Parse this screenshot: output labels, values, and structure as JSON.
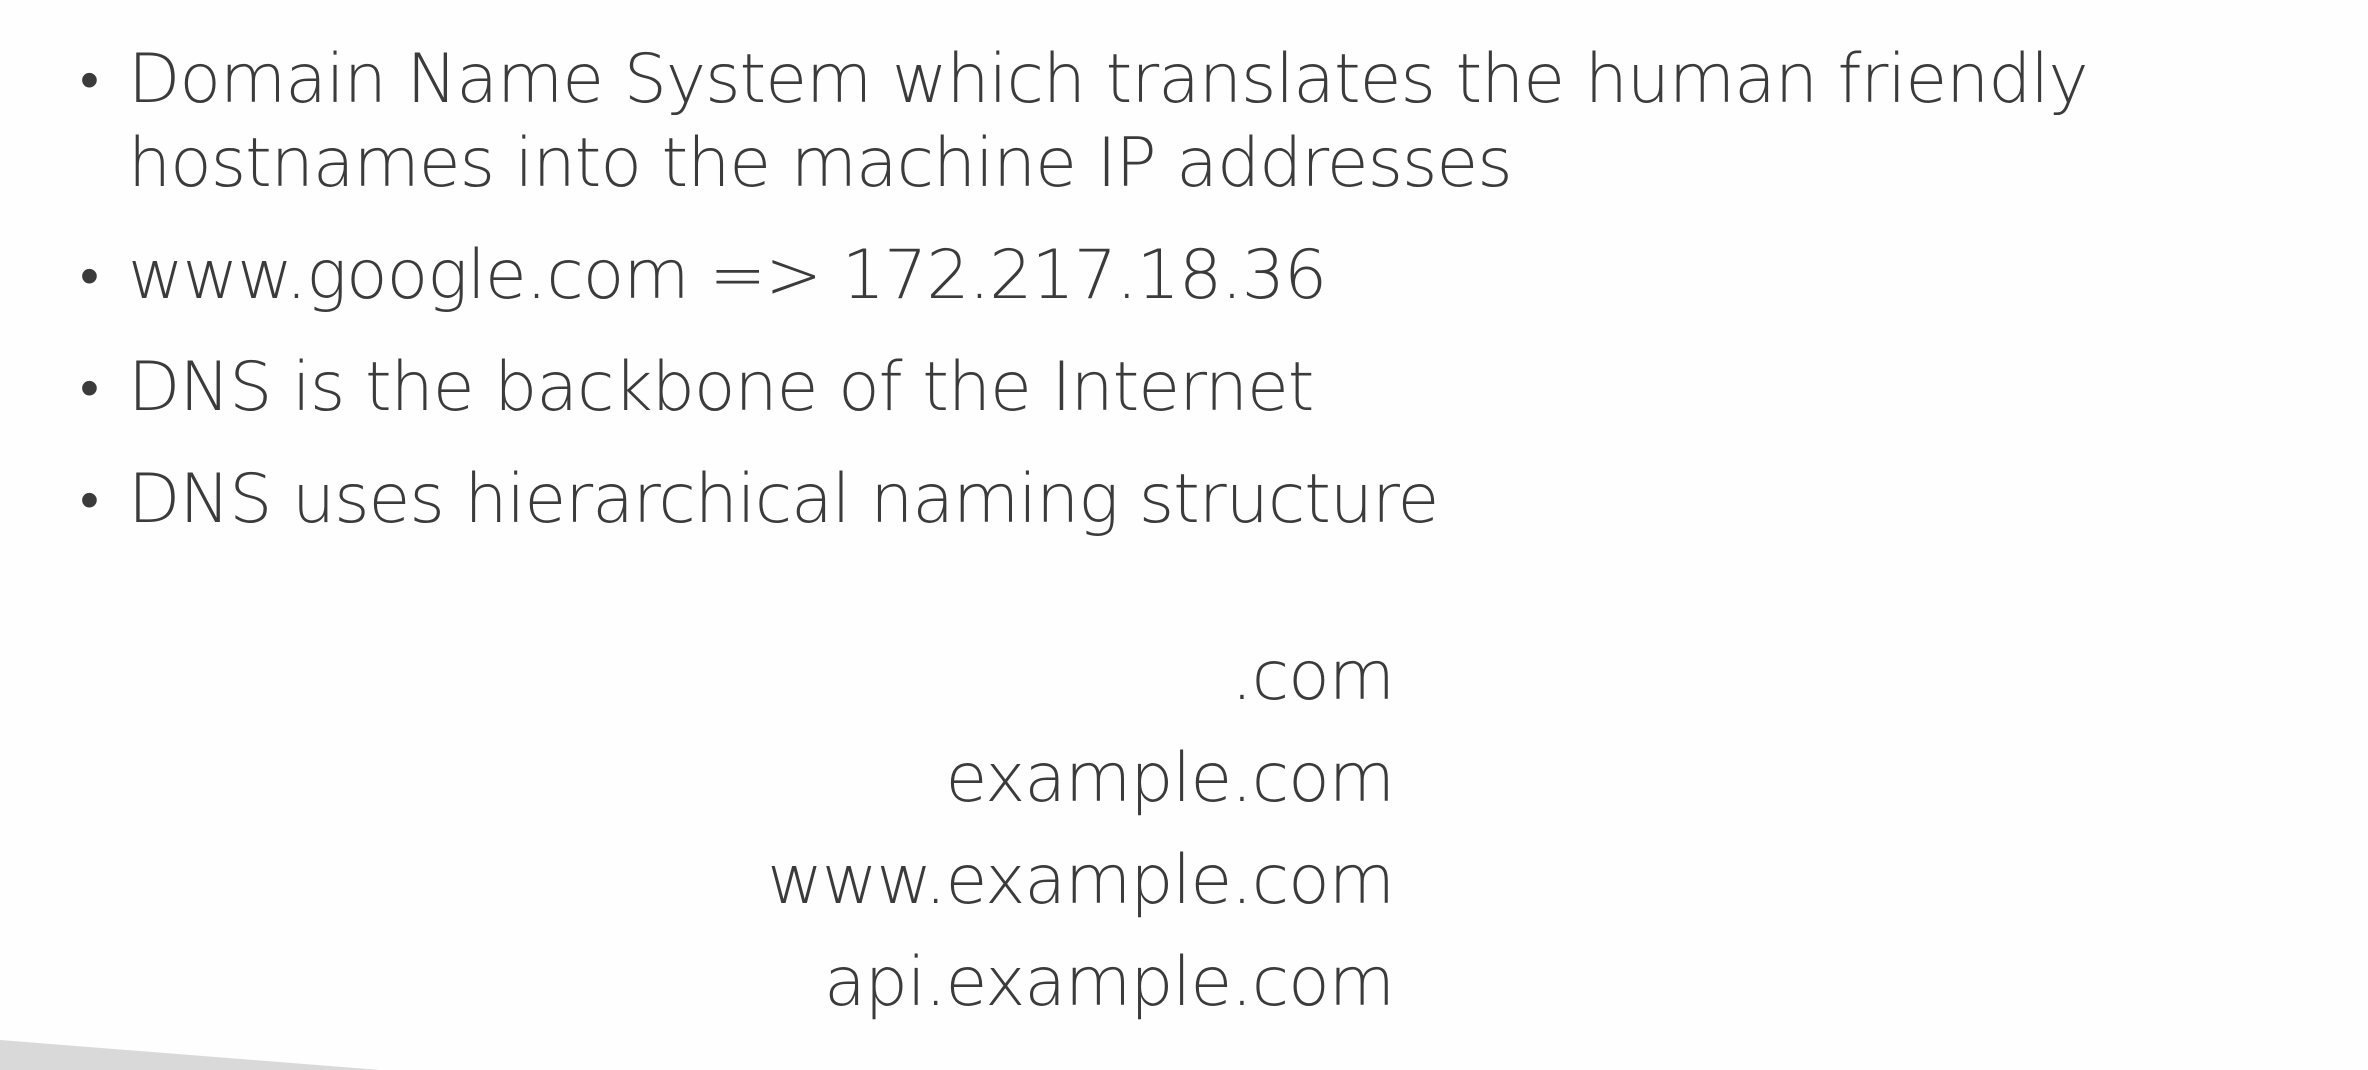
{
  "bullets": [
    {
      "text": "Domain Name System which translates the human friendly hostnames into the machine IP addresses"
    },
    {
      "text": "www.google.com => 172.217.18.36"
    },
    {
      "text": "DNS is the backbone of the Internet"
    },
    {
      "text": "DNS uses hierarchical naming structure"
    }
  ],
  "bullet_symbol": "•",
  "hierarchy": [
    ".com",
    "example.com",
    "www.example.com",
    "api.example.com"
  ],
  "colors": {
    "text": "#3b3b3b",
    "background": "#fefefe",
    "footer_shape": "#d9d9d9"
  }
}
